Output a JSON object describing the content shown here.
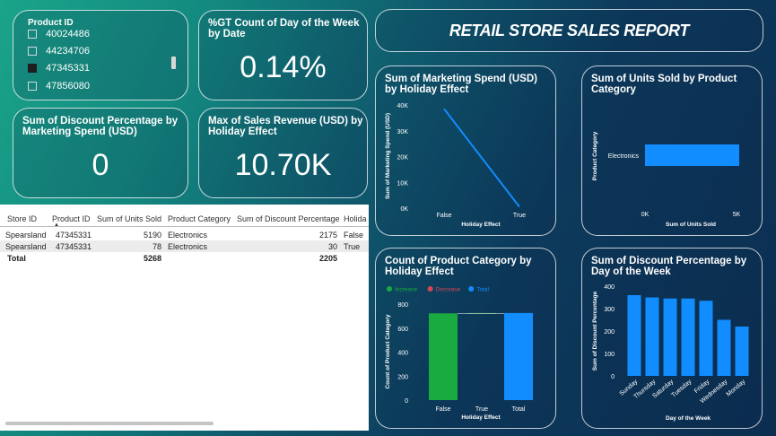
{
  "slicer": {
    "title": "Product ID",
    "items": [
      {
        "label": "40024486",
        "checked": false
      },
      {
        "label": "44234706",
        "checked": false
      },
      {
        "label": "47345331",
        "checked": true
      },
      {
        "label": "47856080",
        "checked": false
      }
    ]
  },
  "kpis": {
    "gt_count": {
      "title": "%GT Count of Day of the Week by Date",
      "value": "0.14%"
    },
    "discount_by_marketing": {
      "title": "Sum of Discount Percentage by Marketing Spend (USD)",
      "value": "0"
    },
    "max_sales": {
      "title": "Max of Sales Revenue (USD) by Holiday Effect",
      "value": "10.70K"
    }
  },
  "report_title": "RETAIL STORE SALES REPORT",
  "table": {
    "headers": [
      "Store ID",
      "Product ID",
      "Sum of Units Sold",
      "Product Category",
      "Sum of Discount Percentage",
      "Holida"
    ],
    "rows": [
      [
        "Spearsland",
        "47345331",
        "5190",
        "Electronics",
        "2175",
        "False"
      ],
      [
        "Spearsland",
        "47345331",
        "78",
        "Electronics",
        "30",
        "True"
      ]
    ],
    "total": [
      "Total",
      "",
      "5268",
      "",
      "2205",
      ""
    ]
  },
  "chart_data": [
    {
      "id": "marketing",
      "type": "line",
      "title": "Sum of Marketing Spend (USD) by Holiday Effect",
      "categories": [
        "False",
        "True"
      ],
      "values": [
        38500,
        500
      ],
      "xlabel": "Holiday Effect",
      "ylabel": "Sum of Marketing Spend (USD)",
      "ylim": [
        0,
        40000
      ],
      "yticks": [
        "0K",
        "10K",
        "20K",
        "30K",
        "40K"
      ],
      "color": "#118DFF"
    },
    {
      "id": "units",
      "type": "bar",
      "orientation": "horizontal",
      "title": "Sum of Units Sold by Product Category",
      "categories": [
        "Electronics"
      ],
      "values": [
        5268
      ],
      "xlabel": "Sum of Units Sold",
      "ylabel": "Product Category",
      "xlim": [
        0,
        5000
      ],
      "xticks": [
        "0K",
        "5K"
      ],
      "color": "#118DFF"
    },
    {
      "id": "category",
      "type": "bar",
      "subtype": "waterfall",
      "title": "Count of Product Category by Holiday Effect",
      "legend": [
        {
          "name": "Increase",
          "color": "#1AAB40"
        },
        {
          "name": "Decrease",
          "color": "#D64554"
        },
        {
          "name": "Total",
          "color": "#118DFF"
        }
      ],
      "categories": [
        "False",
        "True",
        "Total"
      ],
      "values": [
        723,
        3,
        726
      ],
      "colors": [
        "#1AAB40",
        "#1AAB40",
        "#118DFF"
      ],
      "xlabel": "Holiday Effect",
      "ylabel": "Count of Product Category",
      "ylim": [
        0,
        800
      ],
      "yticks": [
        "0",
        "200",
        "400",
        "600",
        "800"
      ]
    },
    {
      "id": "discount",
      "type": "bar",
      "title": "Sum of Discount Percentage by Day of the Week",
      "categories": [
        "Sunday",
        "Thursday",
        "Saturday",
        "Tuesday",
        "Friday",
        "Wednesday",
        "Monday"
      ],
      "values": [
        360,
        350,
        345,
        345,
        335,
        250,
        220
      ],
      "xlabel": "Day of the Week",
      "ylabel": "Sum of Discount Percentage",
      "ylim": [
        0,
        400
      ],
      "yticks": [
        "0",
        "100",
        "200",
        "300",
        "400"
      ],
      "color": "#118DFF"
    }
  ]
}
